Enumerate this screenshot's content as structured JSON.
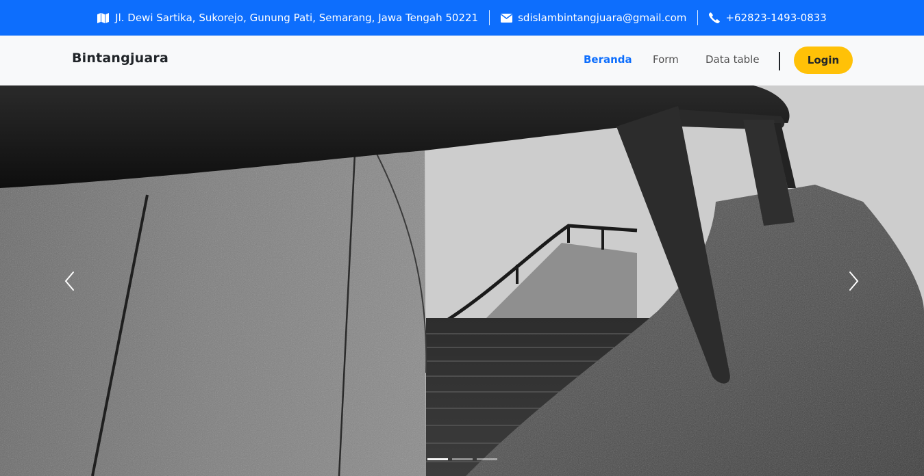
{
  "topbar": {
    "address": "Jl. Dewi Sartika, Sukorejo, Gunung Pati, Semarang, Jawa Tengah 50221",
    "email": "sdislambintangjuara@gmail.com",
    "phone": "+62823-1493-0833",
    "icons": [
      "map-icon",
      "envelope-icon",
      "phone-icon"
    ],
    "color": "#0d6efd"
  },
  "navbar": {
    "brand": "Bintangjuara",
    "links": [
      {
        "label": "Beranda",
        "active": true
      },
      {
        "label": "Form",
        "active": false
      },
      {
        "label": "Data table",
        "active": false
      }
    ],
    "login_label": "Login",
    "login_color": "#ffc107"
  },
  "carousel": {
    "slide_count": 3,
    "active_index": 0,
    "prev_icon": "chevron-left-icon",
    "next_icon": "chevron-right-icon"
  }
}
